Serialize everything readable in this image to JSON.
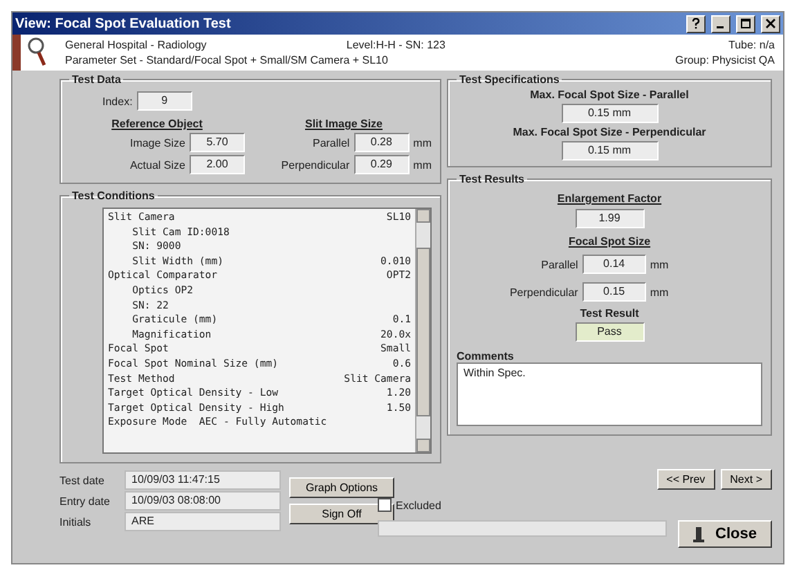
{
  "window": {
    "title": "View: Focal Spot Evaluation Test"
  },
  "header": {
    "facility": "General Hospital - Radiology",
    "level": "Level:H-H - SN: 123",
    "tube": "Tube: n/a",
    "parameter_set": "Parameter Set - Standard/Focal Spot + Small/SM Camera + SL10",
    "group": "Group: Physicist QA"
  },
  "test_data": {
    "title": "Test Data",
    "index_label": "Index:",
    "index": "9",
    "reference_object": {
      "title": "Reference Object",
      "fields": [
        {
          "label": "Image Size",
          "value": "5.70"
        },
        {
          "label": "Actual Size",
          "value": "2.00"
        }
      ]
    },
    "slit_image_size": {
      "title": "Slit Image Size",
      "fields": [
        {
          "label": "Parallel",
          "value": "0.28",
          "unit": "mm"
        },
        {
          "label": "Perpendicular",
          "value": "0.29",
          "unit": "mm"
        }
      ]
    }
  },
  "test_conditions": {
    "title": "Test Conditions",
    "items": [
      {
        "label": "Slit Camera",
        "value": "SL10",
        "children": [
          {
            "label": "Slit Cam ID:0018"
          },
          {
            "label": "SN: 9000"
          },
          {
            "label": "Slit Width (mm)",
            "value": "0.010"
          }
        ]
      },
      {
        "label": "Optical Comparator",
        "value": "OPT2",
        "children": [
          {
            "label": "Optics OP2"
          },
          {
            "label": "SN: 22"
          },
          {
            "label": "Graticule (mm)",
            "value": "0.1"
          },
          {
            "label": "Magnification",
            "value": "20.0x"
          }
        ]
      },
      {
        "label": "Focal Spot",
        "value": "Small"
      },
      {
        "label": "Focal Spot Nominal Size (mm)",
        "value": "0.6"
      },
      {
        "label": "Test Method",
        "value": "Slit Camera"
      },
      {
        "label": "Target Optical Density - Low",
        "value": "1.20"
      },
      {
        "label": "Target Optical Density - High",
        "value": "1.50"
      },
      {
        "label": "Exposure Mode  AEC - Fully Automatic"
      }
    ]
  },
  "test_specifications": {
    "title": "Test Specifications",
    "items": [
      {
        "label": "Max. Focal Spot Size - Parallel",
        "value": "0.15 mm"
      },
      {
        "label": "Max. Focal Spot Size - Perpendicular",
        "value": "0.15 mm"
      }
    ]
  },
  "test_results": {
    "title": "Test Results",
    "enlargement": {
      "label": "Enlargement Factor",
      "value": "1.99"
    },
    "focal_spot_size": {
      "title": "Focal Spot Size",
      "fields": [
        {
          "label": "Parallel",
          "value": "0.14",
          "unit": "mm"
        },
        {
          "label": "Perpendicular",
          "value": "0.15",
          "unit": "mm"
        }
      ]
    },
    "test_result": {
      "label": "Test Result",
      "value": "Pass",
      "passed": true
    },
    "comments": {
      "label": "Comments",
      "value": "Within Spec."
    }
  },
  "footer": {
    "fields": [
      {
        "label": "Test date",
        "value": "10/09/03 11:47:15"
      },
      {
        "label": "Entry date",
        "value": "10/09/03 08:08:00"
      },
      {
        "label": "Initials",
        "value": "ARE"
      }
    ],
    "graph_button": "Graph Options",
    "sign_button": "Sign Off",
    "excluded": {
      "label": "Excluded",
      "checked": false
    },
    "prev_button": "<< Prev",
    "next_button": "Next >",
    "close_button": "Close"
  }
}
